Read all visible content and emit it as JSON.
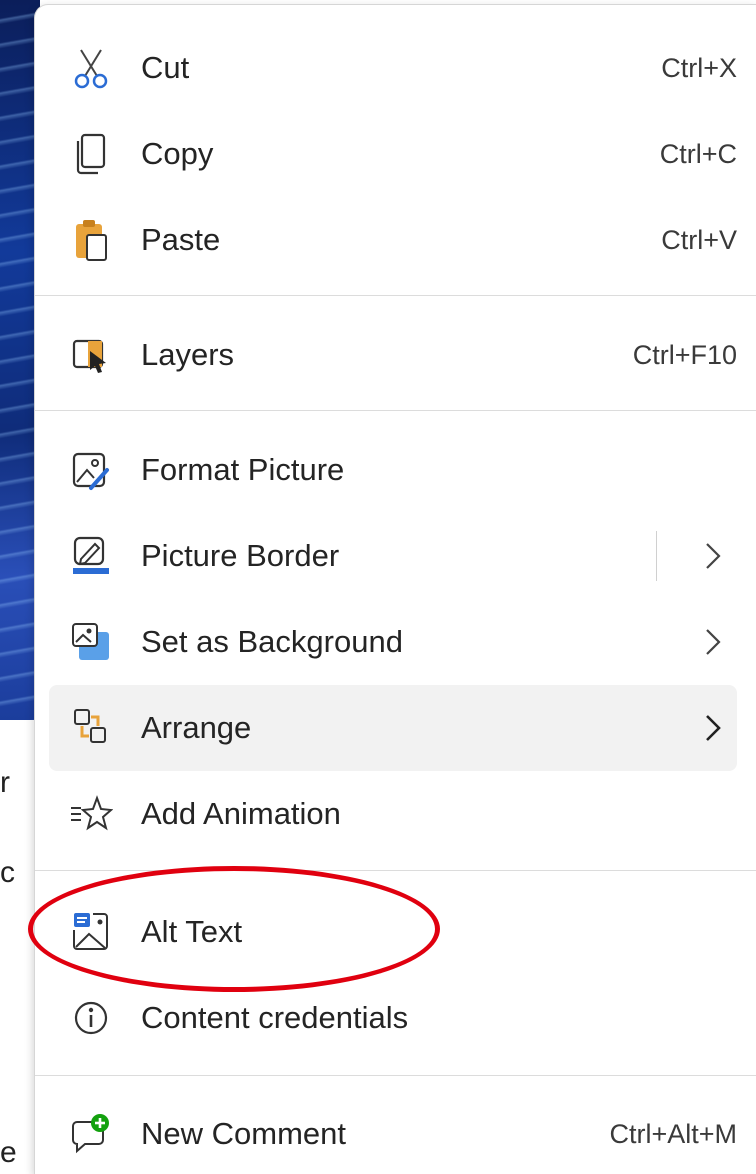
{
  "background": {
    "partial_letters": [
      "r",
      "c",
      "e"
    ]
  },
  "menu": {
    "items": [
      {
        "name": "cut",
        "label": "Cut",
        "shortcut": "Ctrl+X",
        "icon": "scissors-icon"
      },
      {
        "name": "copy",
        "label": "Copy",
        "shortcut": "Ctrl+C",
        "icon": "copy-icon"
      },
      {
        "name": "paste",
        "label": "Paste",
        "shortcut": "Ctrl+V",
        "icon": "clipboard-icon"
      },
      {
        "name": "layers",
        "label": "Layers",
        "shortcut": "Ctrl+F10",
        "icon": "layers-icon"
      },
      {
        "name": "format-picture",
        "label": "Format Picture",
        "icon": "format-picture-icon"
      },
      {
        "name": "picture-border",
        "label": "Picture Border",
        "icon": "pen-border-icon",
        "submenu": true
      },
      {
        "name": "set-as-background",
        "label": "Set as Background",
        "icon": "background-image-icon",
        "submenu": true
      },
      {
        "name": "arrange",
        "label": "Arrange",
        "icon": "arrange-icon",
        "submenu": true,
        "highlighted": true
      },
      {
        "name": "add-animation",
        "label": "Add Animation",
        "icon": "star-animation-icon"
      },
      {
        "name": "alt-text",
        "label": "Alt Text",
        "icon": "alt-text-icon"
      },
      {
        "name": "content-credentials",
        "label": "Content credentials",
        "icon": "info-icon"
      },
      {
        "name": "new-comment",
        "label": "New Comment",
        "shortcut": "Ctrl+Alt+M",
        "icon": "comment-add-icon"
      }
    ]
  },
  "colors": {
    "annotation": "#e0000f",
    "accent_blue": "#2b6cd4",
    "accent_orange": "#e8a33b",
    "comment_green": "#13a10e"
  }
}
